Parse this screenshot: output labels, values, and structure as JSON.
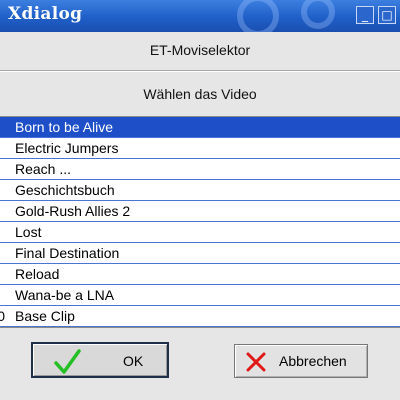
{
  "window": {
    "title": "Xdialog",
    "minimize_label": "_",
    "maximize_label": "□"
  },
  "dialog": {
    "heading": "ET-Moviselektor",
    "prompt": "Wählen das Video"
  },
  "list": {
    "items": [
      {
        "tag": "",
        "label": "Born to be Alive",
        "selected": true
      },
      {
        "tag": "",
        "label": "Electric Jumpers",
        "selected": false
      },
      {
        "tag": "",
        "label": "Reach ...",
        "selected": false
      },
      {
        "tag": "",
        "label": "Geschichtsbuch",
        "selected": false
      },
      {
        "tag": "",
        "label": "Gold-Rush Allies 2",
        "selected": false
      },
      {
        "tag": "",
        "label": "Lost",
        "selected": false
      },
      {
        "tag": "",
        "label": "Final Destination",
        "selected": false
      },
      {
        "tag": "",
        "label": "Reload",
        "selected": false
      },
      {
        "tag": "",
        "label": "Wana-be a LNA",
        "selected": false
      },
      {
        "tag": "0",
        "label": "Base Clip",
        "selected": false
      }
    ]
  },
  "buttons": {
    "ok_label": "OK",
    "cancel_label": "Abbrechen",
    "ok_icon": "check-icon",
    "cancel_icon": "cross-icon"
  },
  "colors": {
    "titlebar": "#1f5fc8",
    "selection": "#1e4fc8",
    "ok_icon": "#22c022",
    "cancel_icon": "#e01818"
  }
}
